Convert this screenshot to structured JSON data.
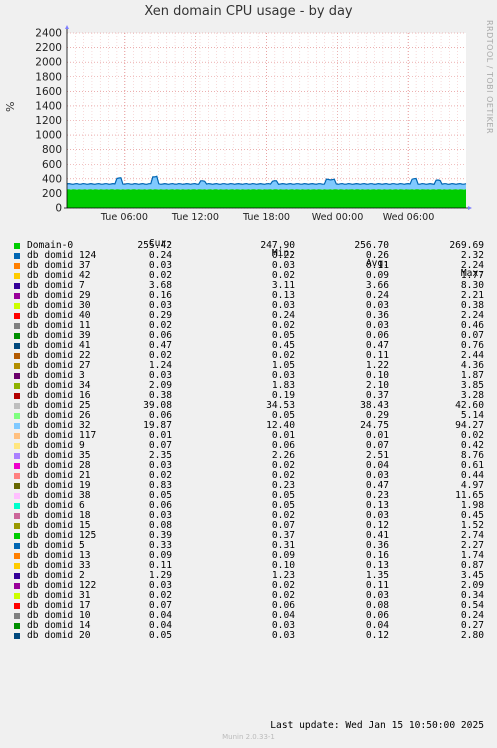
{
  "chart_data": {
    "type": "area",
    "title": "Xen domain CPU usage - by day",
    "ylabel": "%",
    "ylim": [
      0,
      2400
    ],
    "yticks": [
      0,
      200,
      400,
      600,
      800,
      1000,
      1200,
      1400,
      1600,
      1800,
      2000,
      2200,
      2400
    ],
    "xtick_labels": [
      "Tue 06:00",
      "Tue 12:00",
      "Tue 18:00",
      "Wed 00:00",
      "Wed 06:00"
    ],
    "grid": true,
    "stacked_total_approx": 330,
    "domain0_approx": 255,
    "colors": {
      "plot_bg": "#ffffff",
      "grid": "#e08080",
      "domain0": "#00cc00",
      "others": "#0066b3"
    }
  },
  "side_text": "RRDTOOL / TOBI OETIKER",
  "legend_header": {
    "cur": "Cur:",
    "min": "Min:",
    "avg": "Avg:",
    "max": "Max:"
  },
  "legend": [
    {
      "name": "Domain-0",
      "color": "#00cc00",
      "cur": "255.42",
      "min": "247.90",
      "avg": "256.70",
      "max": "269.69"
    },
    {
      "name": "db domid 124",
      "color": "#0066b3",
      "cur": "0.24",
      "min": "0.22",
      "avg": "0.26",
      "max": "2.32"
    },
    {
      "name": "db domid 37",
      "color": "#ff8000",
      "cur": "0.03",
      "min": "0.03",
      "avg": "0.11",
      "max": "2.24"
    },
    {
      "name": "db domid 42",
      "color": "#ffcc00",
      "cur": "0.02",
      "min": "0.02",
      "avg": "0.09",
      "max": "1.77"
    },
    {
      "name": "db domid 7",
      "color": "#330099",
      "cur": "3.68",
      "min": "3.11",
      "avg": "3.66",
      "max": "8.30"
    },
    {
      "name": "db domid 29",
      "color": "#990099",
      "cur": "0.16",
      "min": "0.13",
      "avg": "0.24",
      "max": "2.21"
    },
    {
      "name": "db domid 30",
      "color": "#ccff00",
      "cur": "0.03",
      "min": "0.03",
      "avg": "0.03",
      "max": "0.38"
    },
    {
      "name": "db domid 40",
      "color": "#ff0000",
      "cur": "0.29",
      "min": "0.24",
      "avg": "0.36",
      "max": "2.24"
    },
    {
      "name": "db domid 11",
      "color": "#808080",
      "cur": "0.02",
      "min": "0.02",
      "avg": "0.03",
      "max": "0.46"
    },
    {
      "name": "db domid 39",
      "color": "#008f00",
      "cur": "0.06",
      "min": "0.05",
      "avg": "0.06",
      "max": "0.07"
    },
    {
      "name": "db domid 41",
      "color": "#00487d",
      "cur": "0.47",
      "min": "0.45",
      "avg": "0.47",
      "max": "0.76"
    },
    {
      "name": "db domid 22",
      "color": "#b35a00",
      "cur": "0.02",
      "min": "0.02",
      "avg": "0.11",
      "max": "2.44"
    },
    {
      "name": "db domid 27",
      "color": "#b38f00",
      "cur": "1.24",
      "min": "1.05",
      "avg": "1.22",
      "max": "4.36"
    },
    {
      "name": "db domid 3",
      "color": "#6b006b",
      "cur": "0.03",
      "min": "0.03",
      "avg": "0.10",
      "max": "1.87"
    },
    {
      "name": "db domid 34",
      "color": "#8fb300",
      "cur": "2.09",
      "min": "1.83",
      "avg": "2.10",
      "max": "3.85"
    },
    {
      "name": "db domid 16",
      "color": "#b30000",
      "cur": "0.38",
      "min": "0.19",
      "avg": "0.37",
      "max": "3.28"
    },
    {
      "name": "db domid 25",
      "color": "#bebebe",
      "cur": "39.08",
      "min": "34.53",
      "avg": "38.43",
      "max": "42.60"
    },
    {
      "name": "db domid 26",
      "color": "#80ff80",
      "cur": "0.06",
      "min": "0.05",
      "avg": "0.29",
      "max": "5.14"
    },
    {
      "name": "db domid 32",
      "color": "#80c9ff",
      "cur": "19.87",
      "min": "12.40",
      "avg": "24.75",
      "max": "94.27"
    },
    {
      "name": "db domid 117",
      "color": "#ffc080",
      "cur": "0.01",
      "min": "0.01",
      "avg": "0.01",
      "max": "0.02"
    },
    {
      "name": "db domid 9",
      "color": "#ffe680",
      "cur": "0.07",
      "min": "0.06",
      "avg": "0.07",
      "max": "0.42"
    },
    {
      "name": "db domid 35",
      "color": "#aa80ff",
      "cur": "2.35",
      "min": "2.26",
      "avg": "2.51",
      "max": "8.76"
    },
    {
      "name": "db domid 28",
      "color": "#ee00cc",
      "cur": "0.03",
      "min": "0.02",
      "avg": "0.04",
      "max": "0.61"
    },
    {
      "name": "db domid 21",
      "color": "#ff8080",
      "cur": "0.02",
      "min": "0.02",
      "avg": "0.03",
      "max": "0.44"
    },
    {
      "name": "db domid 19",
      "color": "#666600",
      "cur": "0.83",
      "min": "0.23",
      "avg": "0.47",
      "max": "4.97"
    },
    {
      "name": "db domid 38",
      "color": "#ffbfff",
      "cur": "0.05",
      "min": "0.05",
      "avg": "0.23",
      "max": "11.65"
    },
    {
      "name": "db domid 6",
      "color": "#00ffcc",
      "cur": "0.06",
      "min": "0.05",
      "avg": "0.13",
      "max": "1.98"
    },
    {
      "name": "db domid 18",
      "color": "#cc6699",
      "cur": "0.03",
      "min": "0.02",
      "avg": "0.03",
      "max": "0.45"
    },
    {
      "name": "db domid 15",
      "color": "#999900",
      "cur": "0.08",
      "min": "0.07",
      "avg": "0.12",
      "max": "1.52"
    },
    {
      "name": "db domid 125",
      "color": "#00cc00",
      "cur": "0.39",
      "min": "0.37",
      "avg": "0.41",
      "max": "2.74"
    },
    {
      "name": "db domid 5",
      "color": "#0066b3",
      "cur": "0.33",
      "min": "0.31",
      "avg": "0.36",
      "max": "2.27"
    },
    {
      "name": "db domid 13",
      "color": "#ff8000",
      "cur": "0.09",
      "min": "0.09",
      "avg": "0.16",
      "max": "1.74"
    },
    {
      "name": "db domid 33",
      "color": "#ffcc00",
      "cur": "0.11",
      "min": "0.10",
      "avg": "0.13",
      "max": "0.87"
    },
    {
      "name": "db domid 2",
      "color": "#330099",
      "cur": "1.29",
      "min": "1.23",
      "avg": "1.35",
      "max": "3.45"
    },
    {
      "name": "db domid 122",
      "color": "#990099",
      "cur": "0.03",
      "min": "0.02",
      "avg": "0.11",
      "max": "2.09"
    },
    {
      "name": "db domid 31",
      "color": "#ccff00",
      "cur": "0.02",
      "min": "0.02",
      "avg": "0.03",
      "max": "0.34"
    },
    {
      "name": "db domid 17",
      "color": "#ff0000",
      "cur": "0.07",
      "min": "0.06",
      "avg": "0.08",
      "max": "0.54"
    },
    {
      "name": "db domid 10",
      "color": "#808080",
      "cur": "0.04",
      "min": "0.04",
      "avg": "0.06",
      "max": "0.24"
    },
    {
      "name": "db domid 14",
      "color": "#008f00",
      "cur": "0.04",
      "min": "0.03",
      "avg": "0.04",
      "max": "0.27"
    },
    {
      "name": "db domid 20",
      "color": "#00487d",
      "cur": "0.05",
      "min": "0.03",
      "avg": "0.12",
      "max": "2.80"
    }
  ],
  "last_update": "Last update: Wed Jan 15 10:50:00 2025",
  "footer": "Munin 2.0.33-1"
}
